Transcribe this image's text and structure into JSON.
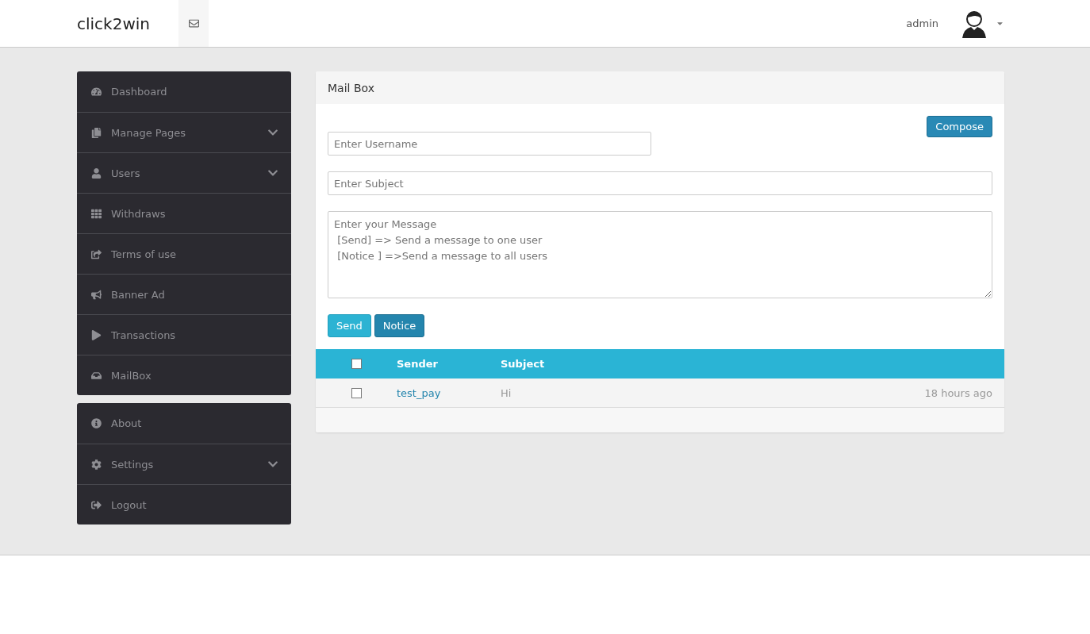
{
  "header": {
    "brand": "click2win",
    "user": "admin"
  },
  "sidebar": {
    "groups": [
      {
        "items": [
          {
            "label": "Dashboard",
            "expandable": false
          },
          {
            "label": "Manage Pages",
            "expandable": true
          },
          {
            "label": "Users",
            "expandable": true
          },
          {
            "label": "Withdraws",
            "expandable": false
          },
          {
            "label": "Terms of use",
            "expandable": false
          },
          {
            "label": "Banner Ad",
            "expandable": false
          },
          {
            "label": "Transactions",
            "expandable": false
          },
          {
            "label": "MailBox",
            "expandable": false
          }
        ]
      },
      {
        "items": [
          {
            "label": "About",
            "expandable": false
          },
          {
            "label": "Settings",
            "expandable": true
          },
          {
            "label": "Logout",
            "expandable": false
          }
        ]
      }
    ]
  },
  "mailbox": {
    "title": "Mail Box",
    "compose": "Compose",
    "username": {
      "placeholder": "Enter Username"
    },
    "subject": {
      "placeholder": "Enter Subject"
    },
    "message": {
      "placeholder": "Enter your Message\n [Send] => Send a message to one user\n [Notice ] =>Send a message to all users"
    },
    "buttons": [
      {
        "label": "Send",
        "kind": "info"
      },
      {
        "label": "Notice",
        "kind": "primary"
      }
    ],
    "table": {
      "all_checked": false,
      "columns": [
        "Sender",
        "Subject"
      ],
      "rows": [
        {
          "checked": false,
          "sender": "test_pay",
          "subject": "Hi",
          "time": "18 hours ago"
        }
      ]
    }
  }
}
